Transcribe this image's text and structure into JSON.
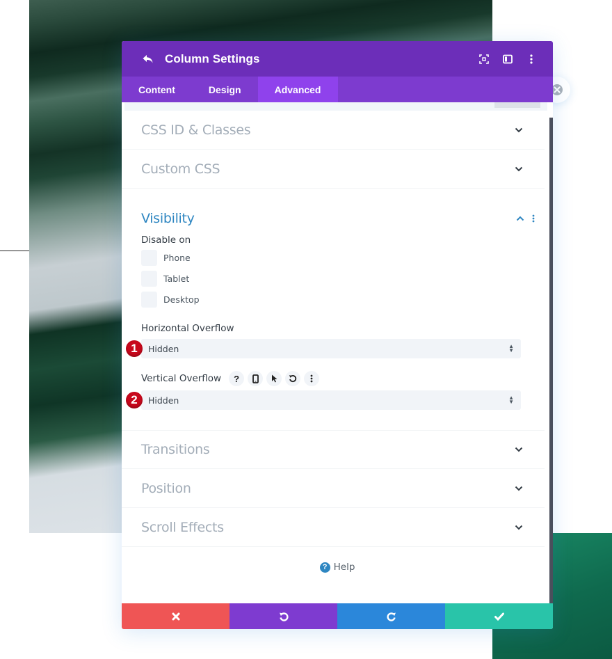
{
  "modal": {
    "title": "Column Settings",
    "header_icons": [
      "back-icon",
      "fullscreen-icon",
      "split-view-icon",
      "more-options-icon"
    ]
  },
  "tabs": [
    {
      "label": "Content",
      "active": false
    },
    {
      "label": "Design",
      "active": false
    },
    {
      "label": "Advanced",
      "active": true
    }
  ],
  "sections_top": [
    {
      "title": "CSS ID & Classes",
      "expanded": false
    },
    {
      "title": "Custom CSS",
      "expanded": false
    }
  ],
  "visibility": {
    "title": "Visibility",
    "expanded": true,
    "disable_on_label": "Disable on",
    "devices": [
      {
        "label": "Phone",
        "checked": false
      },
      {
        "label": "Tablet",
        "checked": false
      },
      {
        "label": "Desktop",
        "checked": false
      }
    ],
    "horizontal_overflow": {
      "label": "Horizontal Overflow",
      "value": "Hidden",
      "badge": "1"
    },
    "vertical_overflow": {
      "label": "Vertical Overflow",
      "value": "Hidden",
      "badge": "2",
      "tool_icons": [
        "help-icon",
        "responsive-phone-icon",
        "hover-cursor-icon",
        "reset-icon",
        "more-options-icon"
      ]
    }
  },
  "sections_bottom": [
    {
      "title": "Transitions",
      "expanded": false
    },
    {
      "title": "Position",
      "expanded": false
    },
    {
      "title": "Scroll Effects",
      "expanded": false
    }
  ],
  "help": {
    "label": "Help",
    "icon": "?"
  },
  "footer": {
    "buttons": [
      {
        "name": "cancel",
        "icon": "close-icon",
        "color": "#ef5555"
      },
      {
        "name": "undo",
        "icon": "undo-icon",
        "color": "#7e3bd0"
      },
      {
        "name": "redo",
        "icon": "redo-icon",
        "color": "#2b87da"
      },
      {
        "name": "save",
        "icon": "checkmark-icon",
        "color": "#29c4a9"
      }
    ]
  },
  "colors": {
    "header": "#6c2eb9",
    "tabs": "#7d3bcf",
    "active_tab": "#8f42ec",
    "accent_blue": "#2e86c1",
    "badge_red": "#c8081c"
  }
}
